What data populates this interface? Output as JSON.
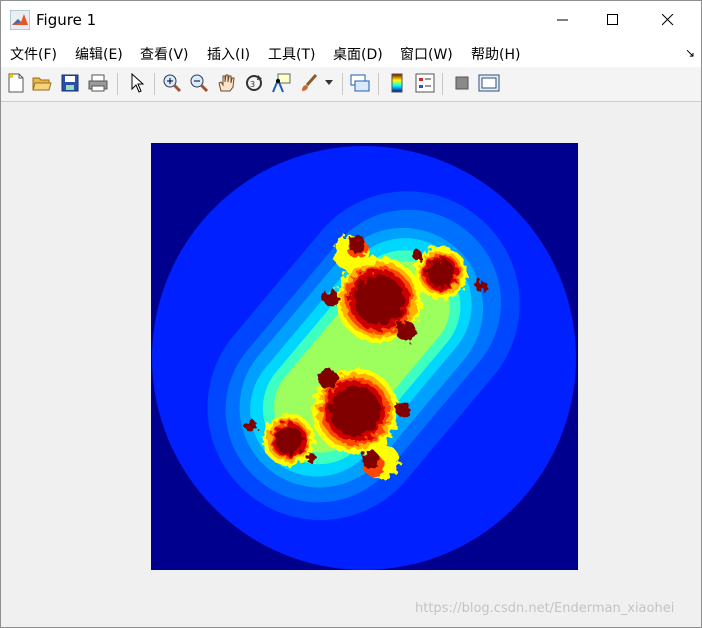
{
  "window": {
    "title": "Figure 1"
  },
  "menu": [
    {
      "label": "文件(F)"
    },
    {
      "label": "编辑(E)"
    },
    {
      "label": "查看(V)"
    },
    {
      "label": "插入(I)"
    },
    {
      "label": "工具(T)"
    },
    {
      "label": "桌面(D)"
    },
    {
      "label": "窗口(W)"
    },
    {
      "label": "帮助(H)"
    }
  ],
  "toolbar": {
    "icons": [
      "new-figure-icon",
      "open-file-icon",
      "save-icon",
      "print-icon",
      "pointer-icon",
      "zoom-in-icon",
      "zoom-out-icon",
      "pan-icon",
      "rotate-3d-icon",
      "data-cursor-icon",
      "brush-icon",
      "link-plot-icon",
      "colorbar-icon",
      "legend-icon",
      "hide-plot-tools-icon",
      "show-plot-tools-icon"
    ]
  },
  "figure": {
    "content": "julia-set-fractal",
    "colormap": "jet",
    "colors": {
      "outer": "#00008f",
      "ring": "#0020ff",
      "core": "#800000"
    }
  },
  "watermark": "https://blog.csdn.net/Enderman_xiaohei"
}
